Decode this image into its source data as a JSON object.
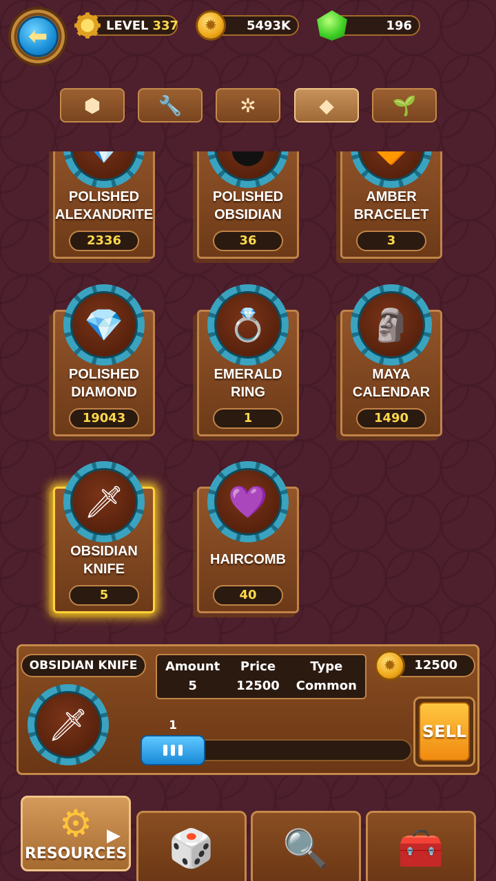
{
  "header": {
    "level_label": "LEVEL",
    "level_value": "337",
    "coins": "5493K",
    "gems": "196"
  },
  "tabs": [
    {
      "icon": "rock-icon",
      "glyph": "⬢"
    },
    {
      "icon": "wrench-icon",
      "glyph": "🔧"
    },
    {
      "icon": "molecule-icon",
      "glyph": "✲"
    },
    {
      "icon": "diamond-icon",
      "glyph": "◆",
      "active": true
    },
    {
      "icon": "plant-icon",
      "glyph": "🌱"
    }
  ],
  "items": [
    {
      "name_line1": "POLISHED",
      "name_line2": "ALEXANDRITE",
      "count": "2336",
      "icon": "alexandrite-gem-icon",
      "glyph": "💎"
    },
    {
      "name_line1": "POLISHED",
      "name_line2": "OBSIDIAN",
      "count": "36",
      "icon": "obsidian-stone-icon",
      "glyph": "⬤"
    },
    {
      "name_line1": "AMBER",
      "name_line2": "BRACELET",
      "count": "3",
      "icon": "amber-bracelet-icon",
      "glyph": "🔶"
    },
    {
      "name_line1": "POLISHED",
      "name_line2": "DIAMOND",
      "count": "19043",
      "icon": "diamond-gem-icon",
      "glyph": "💎"
    },
    {
      "name_line1": "EMERALD",
      "name_line2": "RING",
      "count": "1",
      "icon": "emerald-ring-icon",
      "glyph": "💍"
    },
    {
      "name_line1": "MAYA",
      "name_line2": "CALENDAR",
      "count": "1490",
      "icon": "maya-calendar-icon",
      "glyph": "🗿"
    },
    {
      "name_line1": "OBSIDIAN",
      "name_line2": "KNIFE",
      "count": "5",
      "icon": "obsidian-knife-icon",
      "glyph": "🗡"
    },
    {
      "name_line1": "HAIRCOMB",
      "name_line2": "",
      "count": "40",
      "icon": "haircomb-icon",
      "glyph": "💜"
    }
  ],
  "selected": {
    "name": "OBSIDIAN KNIFE",
    "amount_label": "Amount",
    "amount": "5",
    "price_label": "Price",
    "price": "12500",
    "type_label": "Type",
    "type": "Common",
    "total": "12500",
    "slider_value": "1",
    "sell_label": "SELL"
  },
  "bottom_nav": [
    {
      "label": "RESOURCES",
      "icon": "gear-icon",
      "active": true
    },
    {
      "label": "",
      "icon": "dice-icon"
    },
    {
      "label": "",
      "icon": "magnifier-icon"
    },
    {
      "label": "",
      "icon": "treasure-chest-icon"
    }
  ]
}
